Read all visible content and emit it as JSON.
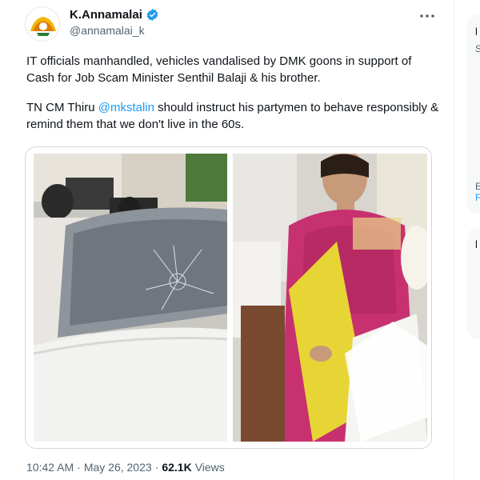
{
  "tweet": {
    "author": {
      "display_name": "K.Annamalai",
      "handle": "@annamalai_k",
      "verified": true,
      "avatar_icon": "party-logo-icon"
    },
    "more_icon": "more-dots-icon",
    "text": {
      "paragraph1": "IT officials manhandled, vehicles vandalised by DMK goons in support of Cash for Job Scam Minister Senthil Balaji & his brother.",
      "paragraph2_before": "TN CM Thiru ",
      "mention": "@mkstalin",
      "paragraph2_after": " should instruct his partymen to behave responsibly & remind them that we don't live in the 60s."
    },
    "media": [
      {
        "alt_icon": "damaged-car-photo"
      },
      {
        "alt_icon": "woman-with-papers-photo"
      }
    ],
    "meta": {
      "time": "10:42 AM",
      "separator": "·",
      "date": "May 26, 2023",
      "views_count": "62.1K",
      "views_label": "Views"
    }
  },
  "sidebar": {
    "letters": [
      "l",
      "S",
      "E",
      "F",
      "l"
    ]
  },
  "colors": {
    "accent": "#1d9bf0",
    "text_primary": "#0f1419",
    "text_secondary": "#536471",
    "border": "#cfd9de"
  }
}
